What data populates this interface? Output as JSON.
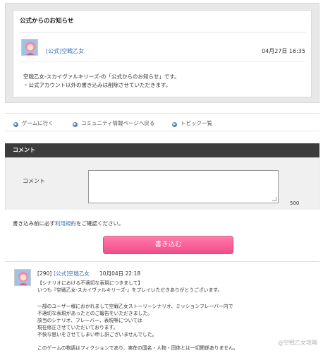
{
  "announcement": {
    "title": "公式からのお知らせ",
    "author": "[公式]空戦乙女",
    "date": "04月27日 16:35",
    "lines": [
      "空戦乙女-スカイヴァルキリーズ-の「公式からのお知らせ」です。",
      "・公式アカウント以外の書き込みは削除させていただきます。"
    ]
  },
  "nav": {
    "items": [
      "ゲームに行く",
      "コミュニティ情報ページへ戻る",
      "トピック一覧"
    ]
  },
  "comment": {
    "header": "コメント",
    "label": "コメント",
    "count": "500",
    "terms_before": "書き込み前に必ず",
    "terms_link": "利用規約",
    "terms_after": "をご確認ください。",
    "submit_label": "書き込む"
  },
  "post": {
    "number": "[290]",
    "author": "[公式]空戦乙女",
    "date": "10月04日 22:18",
    "lines": [
      "【シナリオにおける不適切な表現につきまして】",
      "いつも『空戦乙女-スカイヴァルキリーズ-』をプレイいただきありがとうございます。",
      "",
      "一部のユーザー様におかれまして空戦乙女ストーリーシナリオ、ミッションフレーバー内で",
      "不適切な表現があったとのご報告をいただきました。",
      "該当のシナリオ、フレーバー、表現等については",
      "現在修正させていただいております。",
      "不快な思いをさせてしまい申し訳ございませんでした。",
      "",
      "このゲームの物語はフィクションであり、実在の国名・人物・団体とは一切関係ありません。"
    ]
  },
  "watermark": "@空戦乙女攻略"
}
